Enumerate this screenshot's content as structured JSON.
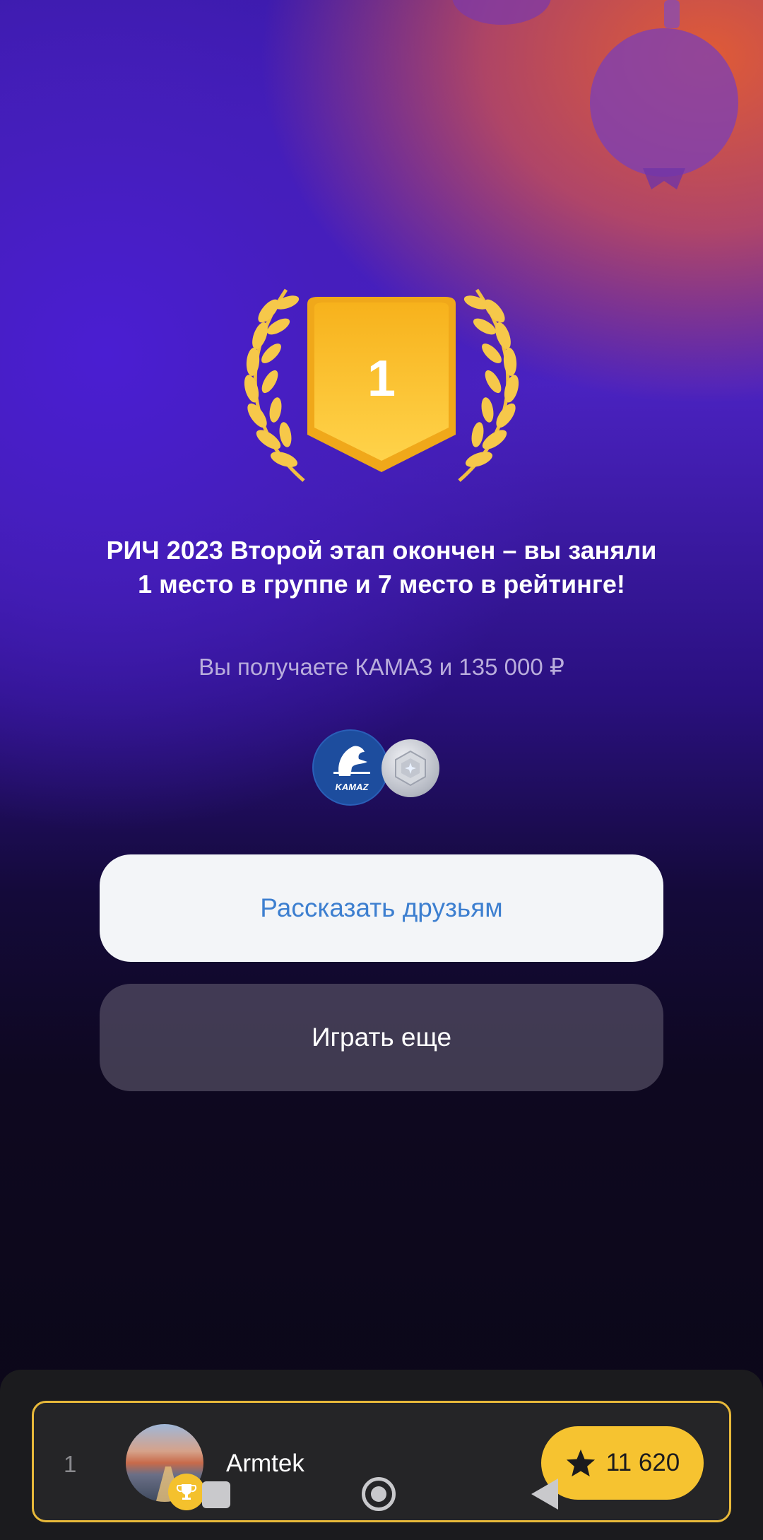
{
  "award": {
    "place": "1"
  },
  "result": {
    "title": "РИЧ 2023 Второй этап окончен – вы заняли 1 место в группе и 7 место в рейтинге!",
    "subtitle": "Вы получаете КАМАЗ и 135 000 ₽"
  },
  "prizes": {
    "kamaz_logo_text": "KAMAZ",
    "icons": [
      "kamaz-logo",
      "silver-badge-icon"
    ]
  },
  "buttons": {
    "share_label": "Рассказать друзьям",
    "play_label": "Играть еще"
  },
  "player": {
    "rank": "1",
    "name": "Armtek",
    "score": "11 620"
  },
  "colors": {
    "accent_gold": "#f6c330",
    "share_text": "#3d7fd0",
    "card_border": "#e8b93a"
  },
  "navigation": {
    "icons": [
      "recent-apps-icon",
      "home-icon",
      "back-icon"
    ]
  }
}
